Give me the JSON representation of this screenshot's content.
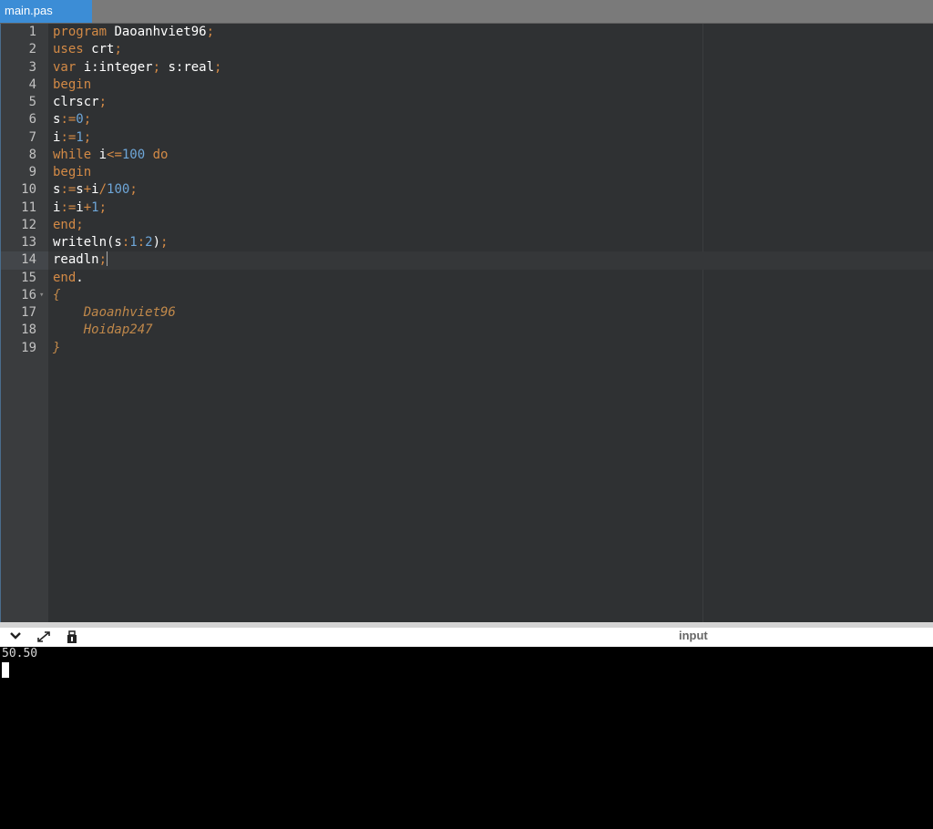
{
  "tab": {
    "label": "main.pas"
  },
  "editor": {
    "active_line": 14,
    "lines": [
      {
        "n": "1",
        "tokens": [
          [
            "kw",
            "program"
          ],
          [
            "id",
            " Daoanhviet96"
          ],
          [
            "op",
            ";"
          ]
        ]
      },
      {
        "n": "2",
        "tokens": [
          [
            "kw",
            "uses"
          ],
          [
            "id",
            " crt"
          ],
          [
            "op",
            ";"
          ]
        ]
      },
      {
        "n": "3",
        "tokens": [
          [
            "kw",
            "var"
          ],
          [
            "id",
            " i:integer"
          ],
          [
            "op",
            ";"
          ],
          [
            "id",
            " s:real"
          ],
          [
            "op",
            ";"
          ]
        ]
      },
      {
        "n": "4",
        "tokens": [
          [
            "kw",
            "begin"
          ]
        ]
      },
      {
        "n": "5",
        "tokens": [
          [
            "id",
            "clrscr"
          ],
          [
            "op",
            ";"
          ]
        ]
      },
      {
        "n": "6",
        "tokens": [
          [
            "id",
            "s"
          ],
          [
            "op",
            ":="
          ],
          [
            "num",
            "0"
          ],
          [
            "op",
            ";"
          ]
        ]
      },
      {
        "n": "7",
        "tokens": [
          [
            "id",
            "i"
          ],
          [
            "op",
            ":="
          ],
          [
            "num",
            "1"
          ],
          [
            "op",
            ";"
          ]
        ]
      },
      {
        "n": "8",
        "tokens": [
          [
            "kw",
            "while"
          ],
          [
            "id",
            " i"
          ],
          [
            "op",
            "<="
          ],
          [
            "num",
            "100"
          ],
          [
            "kw",
            " do"
          ]
        ]
      },
      {
        "n": "9",
        "tokens": [
          [
            "kw",
            "begin"
          ]
        ]
      },
      {
        "n": "10",
        "tokens": [
          [
            "id",
            "s"
          ],
          [
            "op",
            ":="
          ],
          [
            "id",
            "s"
          ],
          [
            "op",
            "+"
          ],
          [
            "id",
            "i"
          ],
          [
            "op",
            "/"
          ],
          [
            "num",
            "100"
          ],
          [
            "op",
            ";"
          ]
        ]
      },
      {
        "n": "11",
        "tokens": [
          [
            "id",
            "i"
          ],
          [
            "op",
            ":="
          ],
          [
            "id",
            "i"
          ],
          [
            "op",
            "+"
          ],
          [
            "num",
            "1"
          ],
          [
            "op",
            ";"
          ]
        ]
      },
      {
        "n": "12",
        "tokens": [
          [
            "kw",
            "end"
          ],
          [
            "op",
            ";"
          ]
        ]
      },
      {
        "n": "13",
        "tokens": [
          [
            "id",
            "writeln(s"
          ],
          [
            "op",
            ":"
          ],
          [
            "num",
            "1"
          ],
          [
            "op",
            ":"
          ],
          [
            "num",
            "2"
          ],
          [
            "id",
            ")"
          ],
          [
            "op",
            ";"
          ]
        ]
      },
      {
        "n": "14",
        "tokens": [
          [
            "id",
            "readln"
          ],
          [
            "op",
            ";"
          ]
        ]
      },
      {
        "n": "15",
        "tokens": [
          [
            "kw",
            "end"
          ],
          [
            "id",
            "."
          ]
        ]
      },
      {
        "n": "16",
        "fold": true,
        "tokens": [
          [
            "cm",
            "{"
          ]
        ]
      },
      {
        "n": "17",
        "tokens": [
          [
            "cm",
            "    Daoanhviet96"
          ]
        ]
      },
      {
        "n": "18",
        "tokens": [
          [
            "cm",
            "    Hoidap247"
          ]
        ]
      },
      {
        "n": "19",
        "tokens": [
          [
            "cm",
            "}"
          ]
        ]
      }
    ]
  },
  "console": {
    "label": "input",
    "output": "50.50",
    "icons": [
      "chevron-down-icon",
      "expand-icon",
      "clear-console-icon"
    ]
  }
}
